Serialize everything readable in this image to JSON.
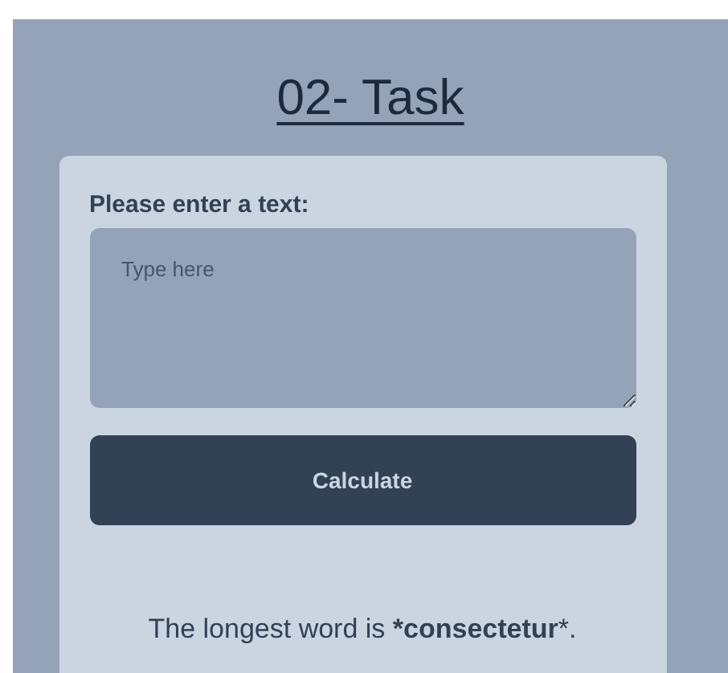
{
  "title": "02- Task",
  "form": {
    "label": "Please enter a text:",
    "placeholder": "Type here",
    "button": "Calculate"
  },
  "result": "The longest word is ***consectetur***."
}
